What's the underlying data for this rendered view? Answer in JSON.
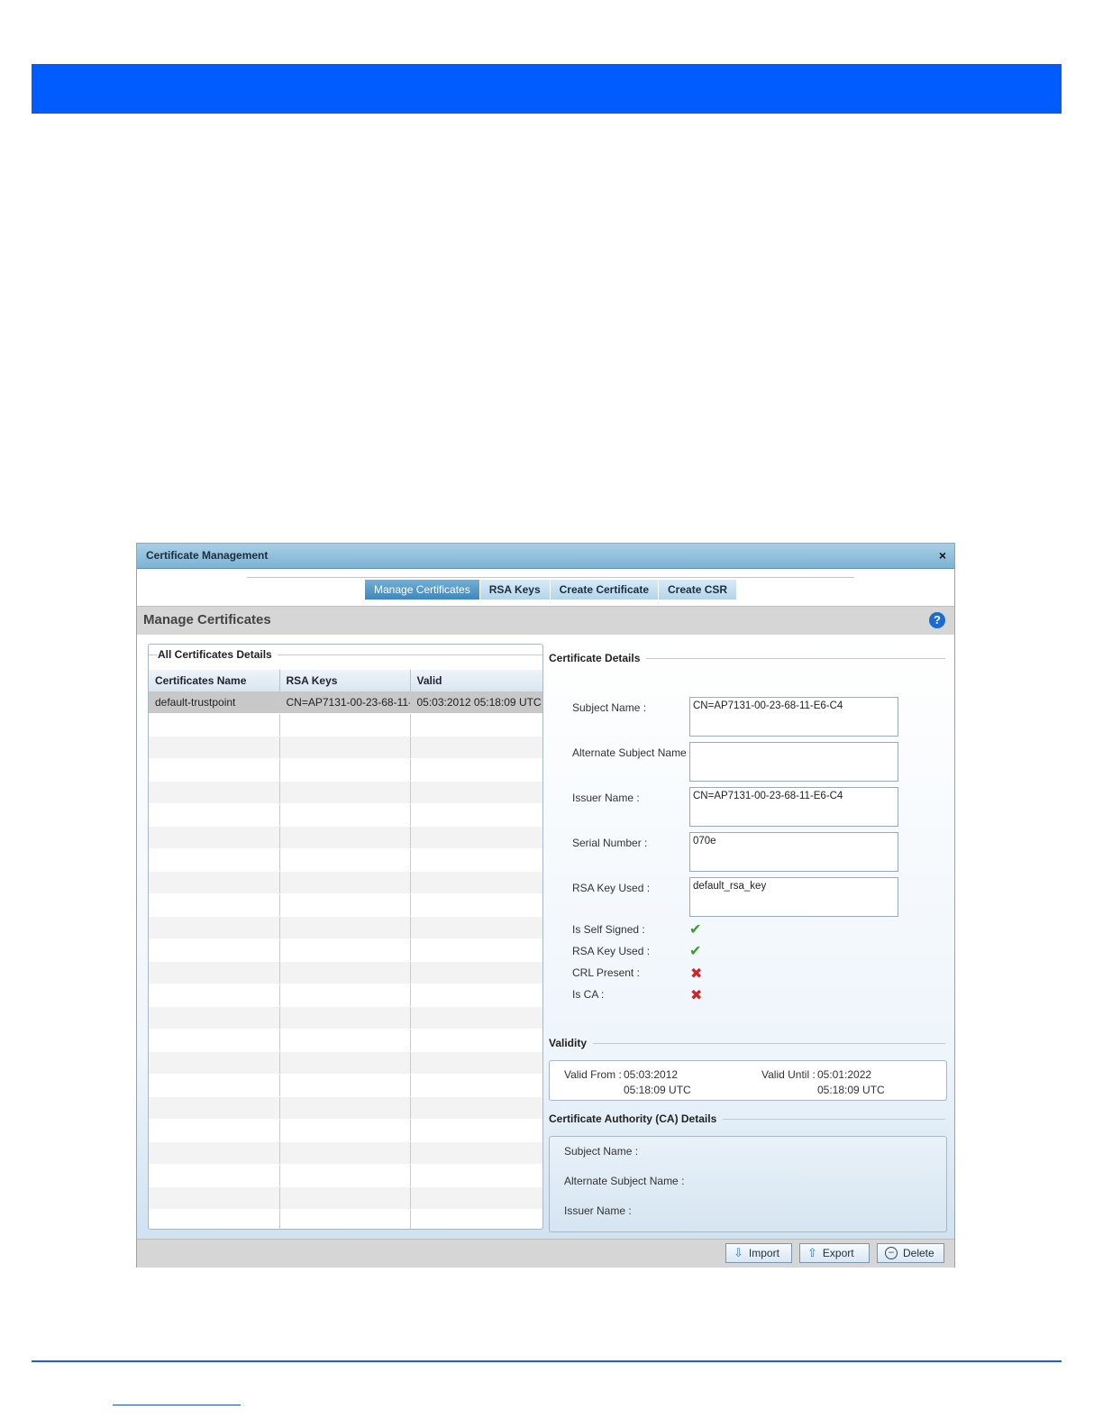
{
  "dialog": {
    "title": "Certificate Management",
    "close_glyph": "×",
    "tabs": [
      {
        "label": "Manage Certificates",
        "active": true
      },
      {
        "label": "RSA Keys",
        "active": false
      },
      {
        "label": "Create Certificate",
        "active": false
      },
      {
        "label": "Create CSR",
        "active": false
      }
    ],
    "section_title": "Manage Certificates",
    "help_glyph": "?",
    "left_panel": {
      "legend": "All Certificates Details",
      "columns": [
        "Certificates Name",
        "RSA Keys",
        "Valid"
      ],
      "rows": [
        [
          "default-trustpoint",
          "CN=AP7131-00-23-68-11-E",
          "05:03:2012 05:18:09 UTC"
        ]
      ]
    },
    "details": {
      "legend": "Certificate Details",
      "subject_name_label": "Subject Name :",
      "subject_name_value": "CN=AP7131-00-23-68-11-E6-C4",
      "alt_subject_name_label": "Alternate Subject Name :",
      "alt_subject_name_value": "",
      "issuer_name_label": "Issuer Name :",
      "issuer_name_value": "CN=AP7131-00-23-68-11-E6-C4",
      "serial_number_label": "Serial Number :",
      "serial_number_value": "070e",
      "rsa_key_used_label": "RSA Key Used :",
      "rsa_key_used_value": "default_rsa_key",
      "is_self_signed_label": "Is Self Signed :",
      "is_self_signed": true,
      "rsa_key_used_flag_label": "RSA Key Used :",
      "rsa_key_used_flag": true,
      "crl_present_label": "CRL Present :",
      "crl_present": false,
      "is_ca_label": "Is CA :",
      "is_ca": false,
      "check_glyph": "✔",
      "cross_glyph": "✖"
    },
    "validity": {
      "legend": "Validity",
      "valid_from_label": "Valid From :",
      "valid_from_date": "05:03:2012",
      "valid_from_time": "05:18:09 UTC",
      "valid_until_label": "Valid Until :",
      "valid_until_date": "05:01:2022",
      "valid_until_time": "05:18:09 UTC"
    },
    "ca_details": {
      "legend": "Certificate Authority (CA) Details",
      "subject_name_label": "Subject Name :",
      "alt_subject_name_label": "Alternate Subject Name :",
      "issuer_name_label": "Issuer Name :"
    },
    "footer": {
      "import_label": "Import",
      "export_label": "Export",
      "delete_label": "Delete",
      "import_icon": "download-arrow-icon",
      "export_icon": "upload-arrow-icon",
      "delete_icon": "minus-circle-icon"
    }
  },
  "colors": {
    "banner": "#005cff",
    "rule": "#1f5fd6",
    "tab_active": "#3f87bc",
    "check": "#3a9b2f",
    "cross": "#d32424"
  }
}
